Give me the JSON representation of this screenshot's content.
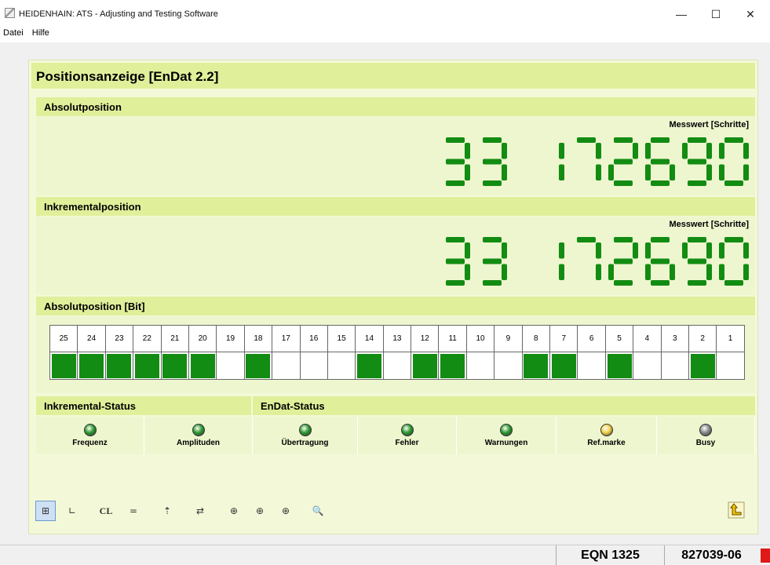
{
  "window": {
    "title": "HEIDENHAIN: ATS - Adjusting and Testing Software",
    "controls": {
      "minimize": "—",
      "maximize": "☐",
      "close": "✕"
    }
  },
  "menu": [
    "Datei",
    "Hilfe"
  ],
  "panel": {
    "title": "Positionsanzeige [EnDat 2.2]",
    "absolute": {
      "title": "Absolutposition",
      "unit_label": "Messwert [Schritte]",
      "value": "33 172690"
    },
    "incremental": {
      "title": "Inkrementalposition",
      "unit_label": "Messwert [Schritte]",
      "value": "33 172690"
    },
    "bits": {
      "title": "Absolutposition [Bit]",
      "numbers": [
        25,
        24,
        23,
        22,
        21,
        20,
        19,
        18,
        17,
        16,
        15,
        14,
        13,
        12,
        11,
        10,
        9,
        8,
        7,
        6,
        5,
        4,
        3,
        2,
        1
      ],
      "values": [
        1,
        1,
        1,
        1,
        1,
        1,
        0,
        1,
        0,
        0,
        0,
        1,
        0,
        1,
        1,
        0,
        0,
        1,
        1,
        0,
        1,
        0,
        0,
        1,
        0
      ]
    },
    "status": {
      "incremental_title": "Inkremental-Status",
      "endat_title": "EnDat-Status",
      "items": [
        {
          "label": "Frequenz",
          "color": "#2e9b2e"
        },
        {
          "label": "Amplituden",
          "color": "#2e9b2e"
        },
        {
          "label": "Übertragung",
          "color": "#2e9b2e"
        },
        {
          "label": "Fehler",
          "color": "#2e9b2e"
        },
        {
          "label": "Warnungen",
          "color": "#2e9b2e"
        },
        {
          "label": "Ref.marke",
          "color": "#f2d24a"
        },
        {
          "label": "Busy",
          "color": "#8a8a8a"
        }
      ]
    }
  },
  "toolbar": {
    "buttons": [
      {
        "icon": "grid-measure-icon",
        "glyph": "⊞",
        "active": true
      },
      {
        "icon": "axis-point-icon",
        "glyph": "∟"
      },
      {
        "icon": "clear-icon",
        "glyph": "CL"
      },
      {
        "icon": "equals-icon",
        "glyph": "="
      },
      {
        "icon": "signal-up-icon",
        "glyph": "⇡"
      },
      {
        "icon": "swap-icon",
        "glyph": "⇄"
      },
      {
        "icon": "crosshair-out-icon",
        "glyph": "⊕"
      },
      {
        "icon": "crosshair-in-icon",
        "glyph": "⊕"
      },
      {
        "icon": "crosshair-info-icon",
        "glyph": "⊕"
      },
      {
        "icon": "magnifier-icon",
        "glyph": "🔍"
      }
    ],
    "back_icon": "return-arrow-icon"
  },
  "statusbar": {
    "device": "EQN 1325",
    "serial": "827039-06",
    "indicator_color": "#e01818"
  },
  "colors": {
    "panel_header": "#e0ef9a",
    "panel_bg": "#f3f9d8",
    "digit_green": "#128c12",
    "bit_on": "#128c12"
  }
}
